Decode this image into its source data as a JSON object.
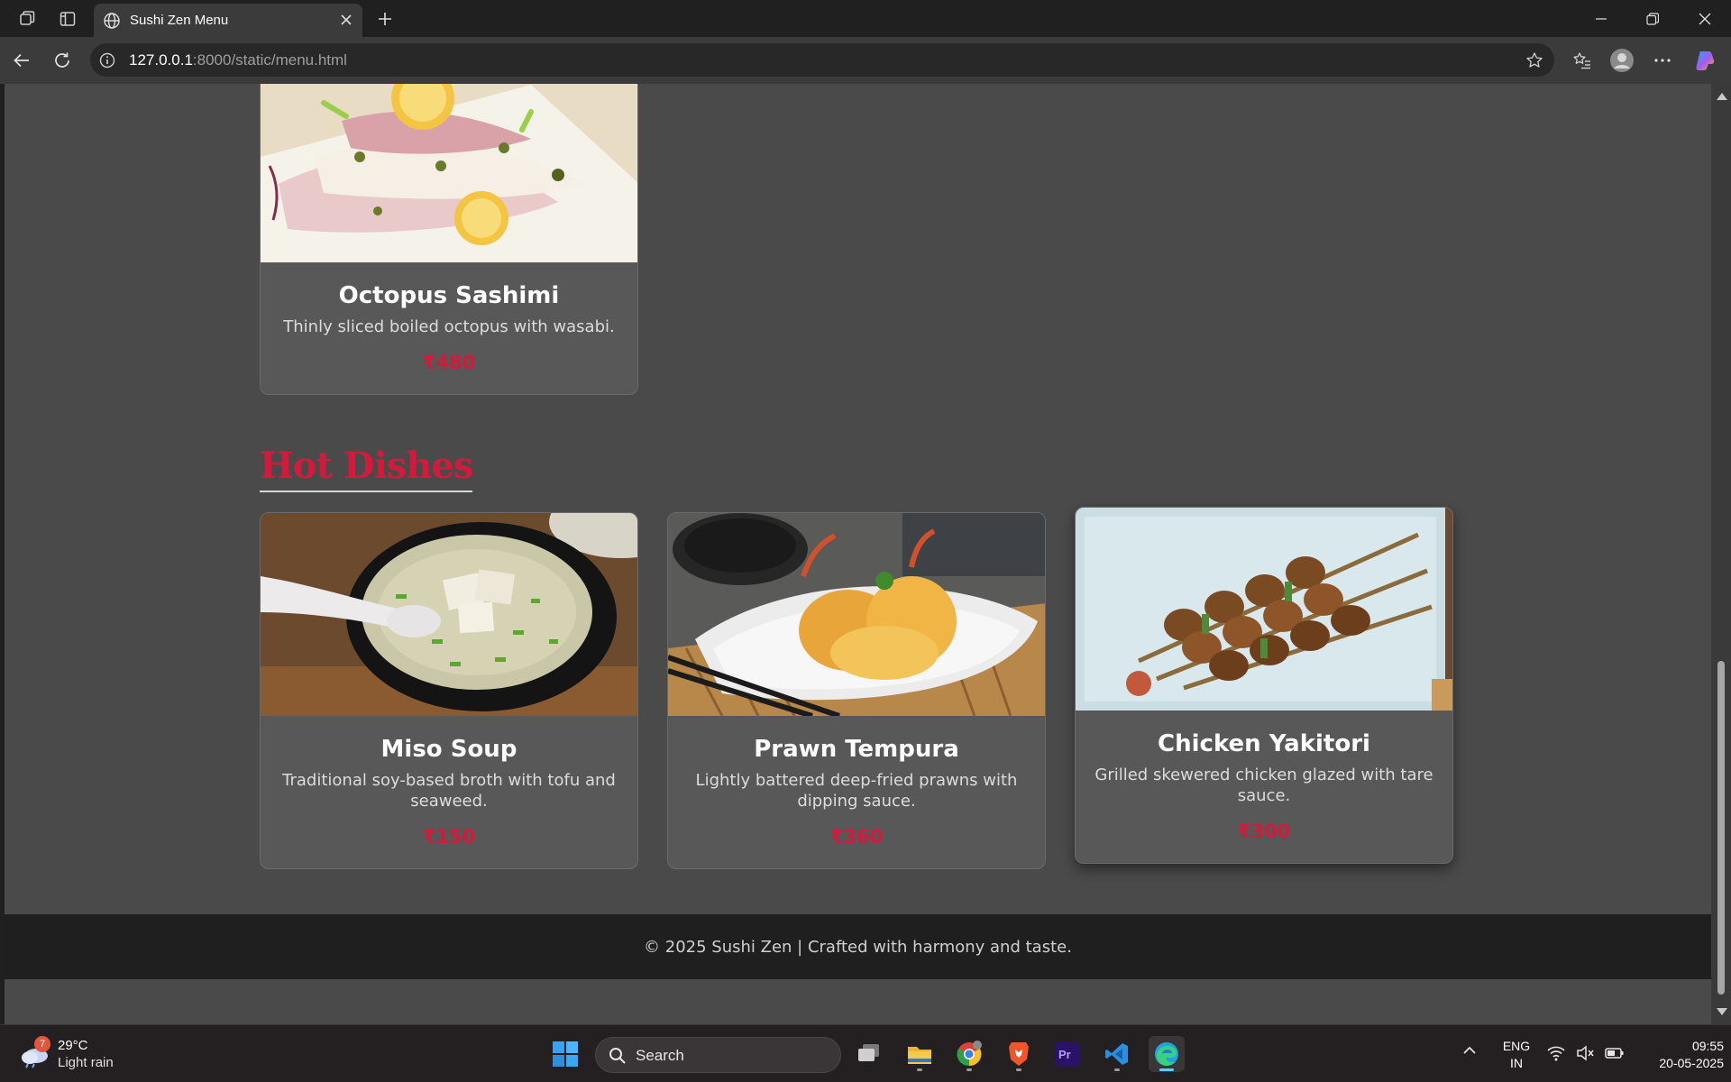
{
  "browser": {
    "tab_title": "Sushi Zen Menu",
    "url_host": "127.0.0.1",
    "url_rest": ":8000/static/menu.html"
  },
  "menu": {
    "top_card": {
      "name": "Octopus Sashimi",
      "description": "Thinly sliced boiled octopus with wasabi.",
      "price": "₹480"
    },
    "hot_dishes": {
      "title": "Hot Dishes",
      "items": [
        {
          "name": "Miso Soup",
          "description": "Traditional soy-based broth with tofu and seaweed.",
          "price": "₹150"
        },
        {
          "name": "Prawn Tempura",
          "description": "Lightly battered deep-fried prawns with dipping sauce.",
          "price": "₹360"
        },
        {
          "name": "Chicken Yakitori",
          "description": "Grilled skewered chicken glazed with tare sauce.",
          "price": "₹300"
        }
      ]
    },
    "footer": "© 2025 Sushi Zen | Crafted with harmony and taste."
  },
  "taskbar": {
    "weather_badge": "7",
    "temperature": "29°C",
    "weather": "Light rain",
    "search_placeholder": "Search",
    "lang_line1": "ENG",
    "lang_line2": "IN",
    "time": "09:55",
    "date": "20-05-2025"
  },
  "colors": {
    "accent": "#d41a3c",
    "page_bg": "#4a4a4a",
    "card_bg": "#585858",
    "footer_bg": "#1f1f1f"
  }
}
